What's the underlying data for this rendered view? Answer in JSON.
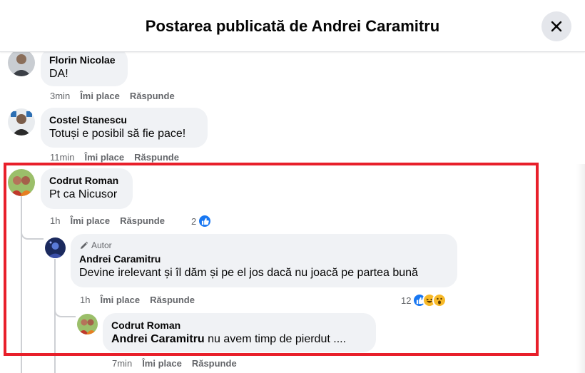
{
  "header": {
    "title": "Postarea publicată de Andrei Caramitru",
    "close_icon": "close-icon"
  },
  "comments": [
    {
      "author": "Florin Nicolae",
      "text": "DA!",
      "time": "3min",
      "like": "Îmi place",
      "reply": "Răspunde"
    },
    {
      "author": "Costel Stanescu",
      "text": "Totuși e posibil să fie pace!",
      "time": "11min",
      "like": "Îmi place",
      "reply": "Răspunde"
    },
    {
      "author": "Codrut Roman",
      "text": "Pt ca Nicusor",
      "time": "1h",
      "like": "Îmi place",
      "reply": "Răspunde",
      "reaction_count": "2"
    }
  ],
  "replies": [
    {
      "badge": "Autor",
      "author": "Andrei Caramitru",
      "text": "Devine irelevant și îl dăm și pe el jos dacă nu joacă pe partea bună",
      "time": "1h",
      "like": "Îmi place",
      "reply": "Răspunde",
      "reaction_count": "12"
    },
    {
      "author": "Codrut Roman",
      "mention": "Andrei Caramitru",
      "text": " nu avem timp de pierdut ....",
      "time": "7min",
      "like": "Îmi place",
      "reply": "Răspunde"
    }
  ],
  "colors": {
    "highlight": "#e81f2a",
    "like_blue": "#1877f2",
    "bubble": "#f0f2f5"
  }
}
